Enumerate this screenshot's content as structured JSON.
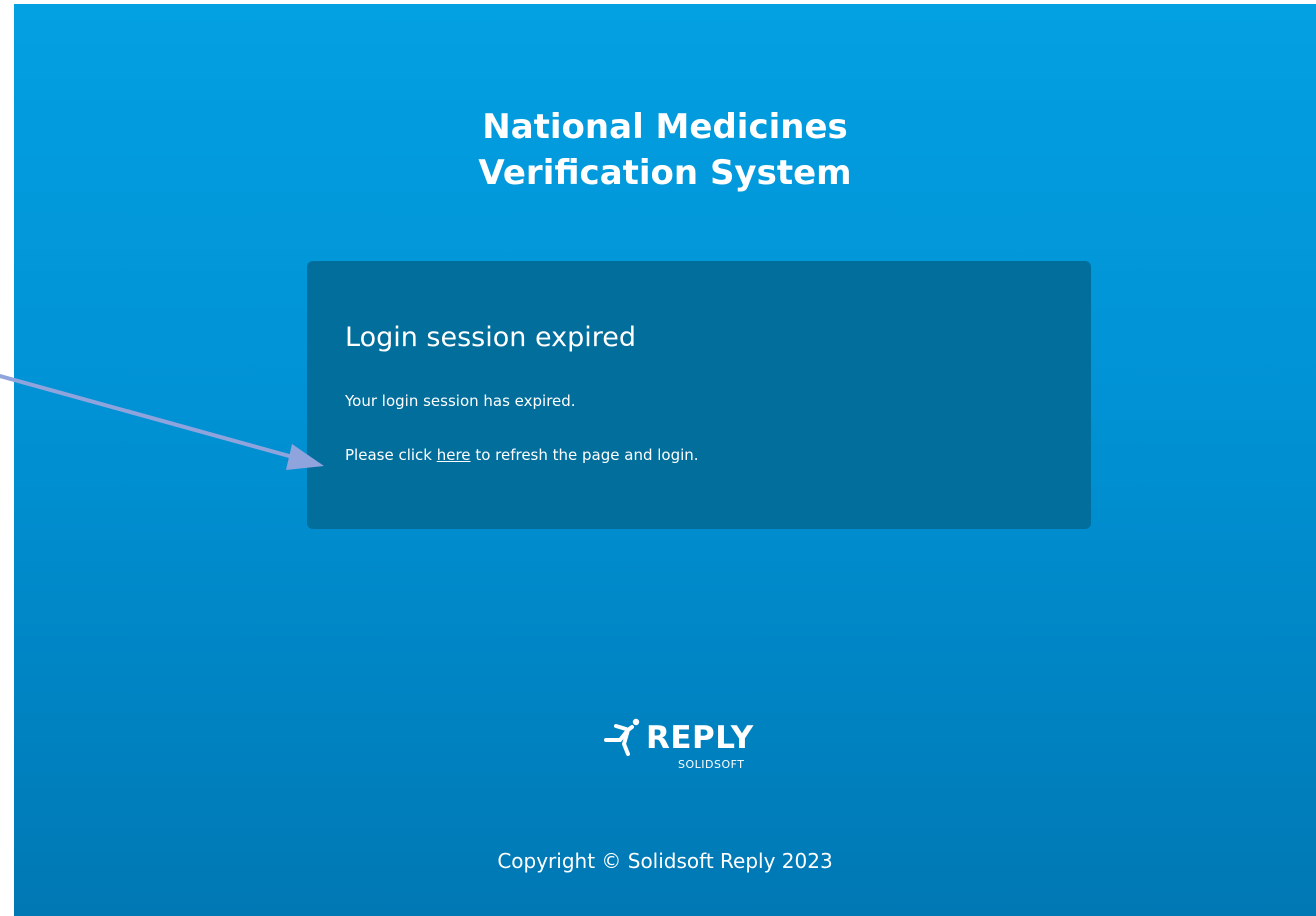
{
  "header": {
    "title_line1": "National Medicines",
    "title_line2": "Verification System"
  },
  "message": {
    "heading": "Login session expired",
    "line1": "Your login session has expired.",
    "line2_prefix": "Please click ",
    "line2_link": "here",
    "line2_suffix": " to refresh the page and login."
  },
  "footer": {
    "logo_text": "REPLY",
    "logo_subtext": "SOLIDSOFT",
    "logo_icon": "running-figure-icon",
    "copyright": "Copyright © Solidsoft Reply 2023"
  },
  "annotation": {
    "icon": "arrow-icon",
    "color": "#8fa4dc"
  },
  "colors": {
    "background_top": "#03a0e2",
    "background_bottom": "#0078b4",
    "card": "#016e9c",
    "text": "#ffffff"
  }
}
